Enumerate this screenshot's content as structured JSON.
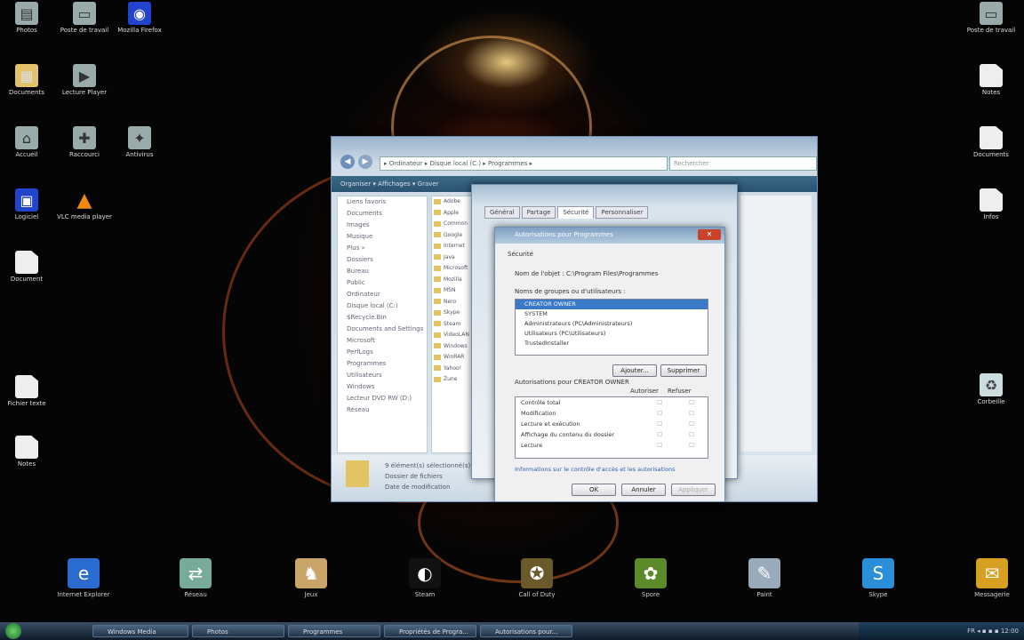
{
  "desktop_left": [
    {
      "name": "Photos",
      "icon": "photos-icon"
    },
    {
      "name": "Poste de travail",
      "icon": "computer-icon"
    },
    {
      "name": "Mozilla Firefox",
      "icon": "firefox-icon"
    },
    {
      "name": "Documents",
      "icon": "documents-folder-icon"
    },
    {
      "name": "Lecture Player",
      "icon": "media-player-icon"
    },
    {
      "name": "Accueil",
      "icon": "home-icon"
    },
    {
      "name": "Raccourci",
      "icon": "shortcut-icon"
    },
    {
      "name": "Antivirus",
      "icon": "antivirus-icon"
    },
    {
      "name": "Logiciel",
      "icon": "software-icon"
    },
    {
      "name": "VLC media player",
      "icon": "vlc-cone-icon"
    },
    {
      "name": "Document",
      "icon": "document-icon"
    },
    {
      "name": "Fichier texte",
      "icon": "text-file-icon"
    },
    {
      "name": "Notes",
      "icon": "notes-icon"
    }
  ],
  "desktop_right": [
    {
      "name": "Poste de travail",
      "icon": "computer-icon"
    },
    {
      "name": "Notes",
      "icon": "document-icon"
    },
    {
      "name": "Documents",
      "icon": "document-icon"
    },
    {
      "name": "Infos",
      "icon": "document-icon"
    },
    {
      "name": "Corbeille",
      "icon": "recycle-bin-icon"
    }
  ],
  "dock": [
    {
      "name": "Internet Explorer",
      "icon": "internet-explorer-icon"
    },
    {
      "name": "Réseau",
      "icon": "network-icon"
    },
    {
      "name": "Jeux",
      "icon": "games-icon"
    },
    {
      "name": "Steam",
      "icon": "steam-icon"
    },
    {
      "name": "Call of Duty",
      "icon": "game-icon"
    },
    {
      "name": "Spore",
      "icon": "spore-icon"
    },
    {
      "name": "Paint",
      "icon": "paint-icon"
    },
    {
      "name": "Skype",
      "icon": "skype-icon"
    },
    {
      "name": "Messagerie",
      "icon": "messenger-icon"
    }
  ],
  "explorer": {
    "address": "▸ Ordinateur ▸ Disque local (C:) ▸ Programmes ▸",
    "search_placeholder": "Rechercher",
    "toolbar": "Organiser ▾   Affichages ▾   Graver",
    "nav_items": [
      "Liens favoris",
      "Documents",
      "Images",
      "Musique",
      "Plus »",
      "Dossiers",
      "Bureau",
      "Public",
      "Ordinateur",
      "Disque local (C:)",
      "$Recycle.Bin",
      "Documents and Settings",
      "Microsoft",
      "PerfLogs",
      "Programmes",
      "Utilisateurs",
      "Windows",
      "Lecteur DVD RW (D:)",
      "Réseau"
    ],
    "files": [
      "Adobe",
      "Apple",
      "Common",
      "Google",
      "Internet",
      "Java",
      "Microsoft",
      "Mozilla",
      "MSN",
      "Nero",
      "Skype",
      "Steam",
      "VideoLAN",
      "Windows",
      "WinRAR",
      "Yahoo!",
      "Zune"
    ],
    "details_line1": "9 élément(s) sélectionné(s)",
    "details_line2": "Dossier de fichiers",
    "details_line3": "Date de modification"
  },
  "properties": {
    "tabs": [
      "Général",
      "Partage",
      "Sécurité",
      "Personnaliser"
    ],
    "active_tab": "Sécurité"
  },
  "permissions": {
    "title": "Autorisations pour Programmes",
    "section": "Sécurité",
    "object_label": "Nom de l'objet :",
    "object_value": "C:\\Program Files\\Programmes",
    "groups_label": "Noms de groupes ou d'utilisateurs :",
    "groups": [
      "CREATOR OWNER",
      "SYSTEM",
      "Administrateurs (PC\\Administrateurs)",
      "Utilisateurs (PC\\Utilisateurs)",
      "TrustedInstaller"
    ],
    "add_button": "Ajouter...",
    "remove_button": "Supprimer",
    "perm_label": "Autorisations pour CREATOR OWNER",
    "col_allow": "Autoriser",
    "col_deny": "Refuser",
    "perm_rows": [
      "Contrôle total",
      "Modification",
      "Lecture et exécution",
      "Affichage du contenu du dossier",
      "Lecture"
    ],
    "help_link": "Informations sur le contrôle d'accès et les autorisations",
    "ok": "OK",
    "cancel": "Annuler",
    "apply": "Appliquer"
  },
  "taskbar": {
    "buttons": [
      "Windows Media",
      "Photos",
      "Programmes",
      "Propriétés de Progra...",
      "Autorisations pour..."
    ],
    "tray": "FR  ◂ ▪ ▪ ▪  12:00"
  },
  "colors": {
    "taskbar": "#1e2f44",
    "selection": "#3a78c8",
    "window_frame": "#9ab3cc"
  }
}
